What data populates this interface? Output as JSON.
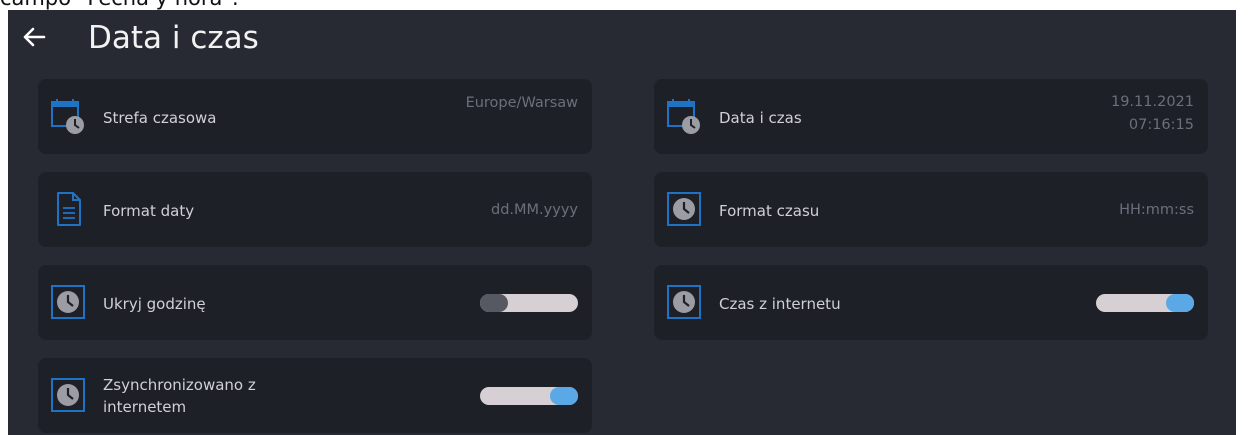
{
  "caption": "campo \"Fecha y hora\".",
  "header": {
    "title": "Data i czas",
    "back_icon": "arrow-left-icon"
  },
  "settings": [
    {
      "label": "Strefa czasowa",
      "value": "Europe/Warsaw",
      "icon": "calendar-clock-icon"
    },
    {
      "label": "Data i czas",
      "value_date": "19.11.2021",
      "value_time": "07:16:15",
      "icon": "calendar-clock-icon"
    },
    {
      "label": "Format daty",
      "value": "dd.MM.yyyy",
      "icon": "document-icon"
    },
    {
      "label": "Format czasu",
      "value": "HH:mm:ss",
      "icon": "clock-icon"
    },
    {
      "label": "Ukryj godzinę",
      "toggle": false,
      "icon": "clock-icon"
    },
    {
      "label": "Czas z internetu",
      "toggle": true,
      "icon": "clock-icon"
    },
    {
      "label_line1": "Zsynchronizowano z",
      "label_line2": "internetem",
      "toggle": true,
      "icon": "clock-icon"
    }
  ],
  "colors": {
    "background": "#282a33",
    "card": "#1e2028",
    "accent": "#1f73c4",
    "toggle_on": "#5aa9e6"
  }
}
